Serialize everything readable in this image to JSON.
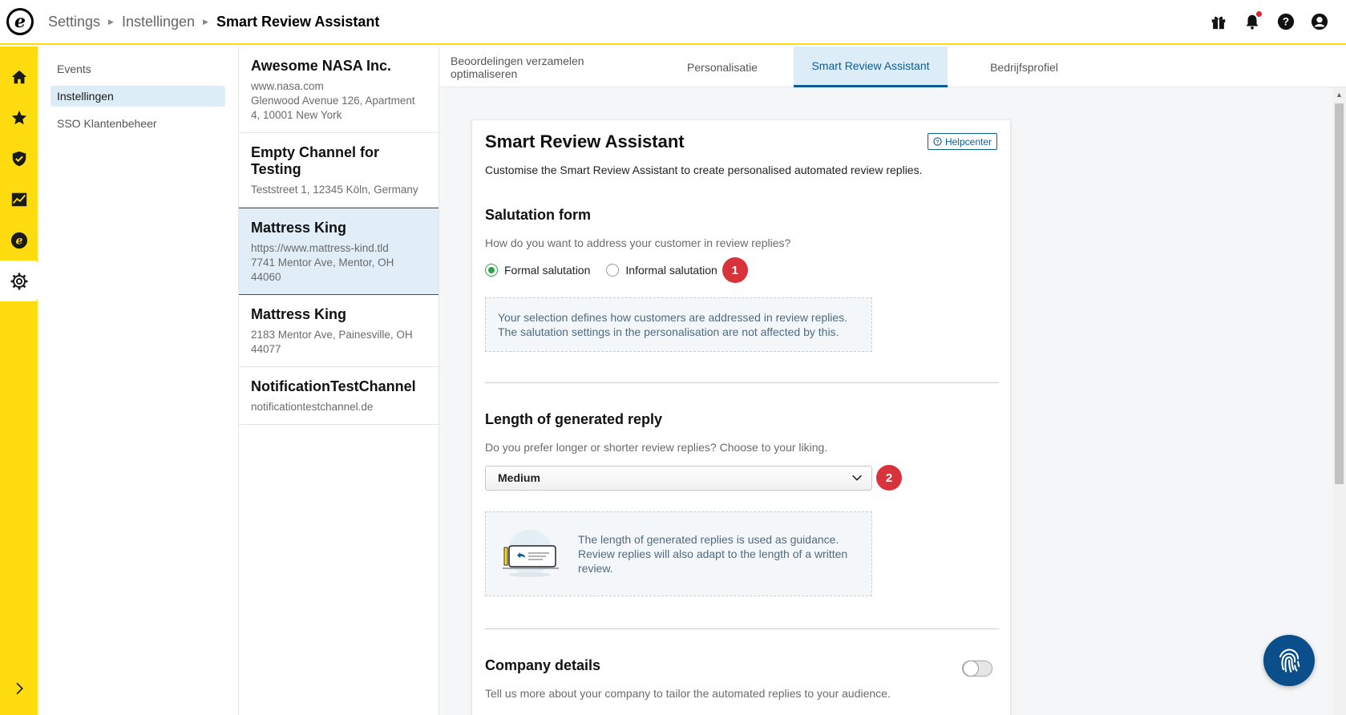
{
  "breadcrumb": {
    "items": [
      "Settings",
      "Instellingen",
      "Smart Review Assistant"
    ]
  },
  "colors": {
    "accent_yellow": "#ffdc0f",
    "primary_blue": "#0a5c9a",
    "badge_red": "#d8323b",
    "radio_green": "#2aa34a"
  },
  "top_icons": [
    "gift-icon",
    "bell-icon",
    "help-icon",
    "user-icon"
  ],
  "rail": {
    "items": [
      "home-icon",
      "star-icon",
      "shield-check-icon",
      "analytics-icon",
      "etrusted-icon",
      "gear-icon"
    ],
    "active": "gear-icon"
  },
  "subnav": {
    "items": [
      {
        "label": "Events"
      },
      {
        "label": "Instellingen",
        "active": true
      },
      {
        "label": "SSO Klantenbeheer"
      }
    ]
  },
  "channels": [
    {
      "name": "Awesome NASA Inc.",
      "lines": [
        "www.nasa.com",
        "Glenwood Avenue 126, Apartment",
        "4, 10001 New York"
      ]
    },
    {
      "name": "Empty Channel for Testing",
      "lines": [
        "Teststreet 1, 12345 Köln, Germany"
      ]
    },
    {
      "name": "Mattress King",
      "lines": [
        "https://www.mattress-kind.tld",
        "7741 Mentor Ave, Mentor, OH",
        "44060"
      ],
      "active": true
    },
    {
      "name": "Mattress King",
      "lines": [
        "2183 Mentor Ave, Painesville, OH",
        "44077"
      ]
    },
    {
      "name": "NotificationTestChannel",
      "lines": [
        "notificationtestchannel.de"
      ]
    }
  ],
  "tabs": [
    {
      "label": "Beoordelingen verzamelen optimaliseren"
    },
    {
      "label": "Personalisatie"
    },
    {
      "label": "Smart Review Assistant",
      "active": true
    },
    {
      "label": "Bedrijfsprofiel"
    }
  ],
  "card": {
    "title": "Smart Review Assistant",
    "helpcenter": "Helpcenter",
    "description": "Customise the Smart Review Assistant to create personalised automated review replies.",
    "salutation": {
      "title": "Salutation form",
      "question": "How do you want to address your customer in review replies?",
      "options": [
        "Formal salutation",
        "Informal salutation"
      ],
      "selected": "Formal salutation",
      "badge": "1",
      "info_line1": "Your selection defines how customers are addressed in review replies.",
      "info_line2": "The salutation settings in the personalisation are not affected by this."
    },
    "length": {
      "title": "Length of generated reply",
      "question": "Do you prefer longer or shorter review replies? Choose to your liking.",
      "selected": "Medium",
      "badge": "2",
      "info_line1": "The length of generated replies is used as guidance.",
      "info_line2": "Review replies will also adapt to the length of a written",
      "info_line3": "review."
    },
    "company": {
      "title": "Company details",
      "question": "Tell us more about your company to tailor the automated replies to your audience.",
      "toggle_on": false
    }
  }
}
